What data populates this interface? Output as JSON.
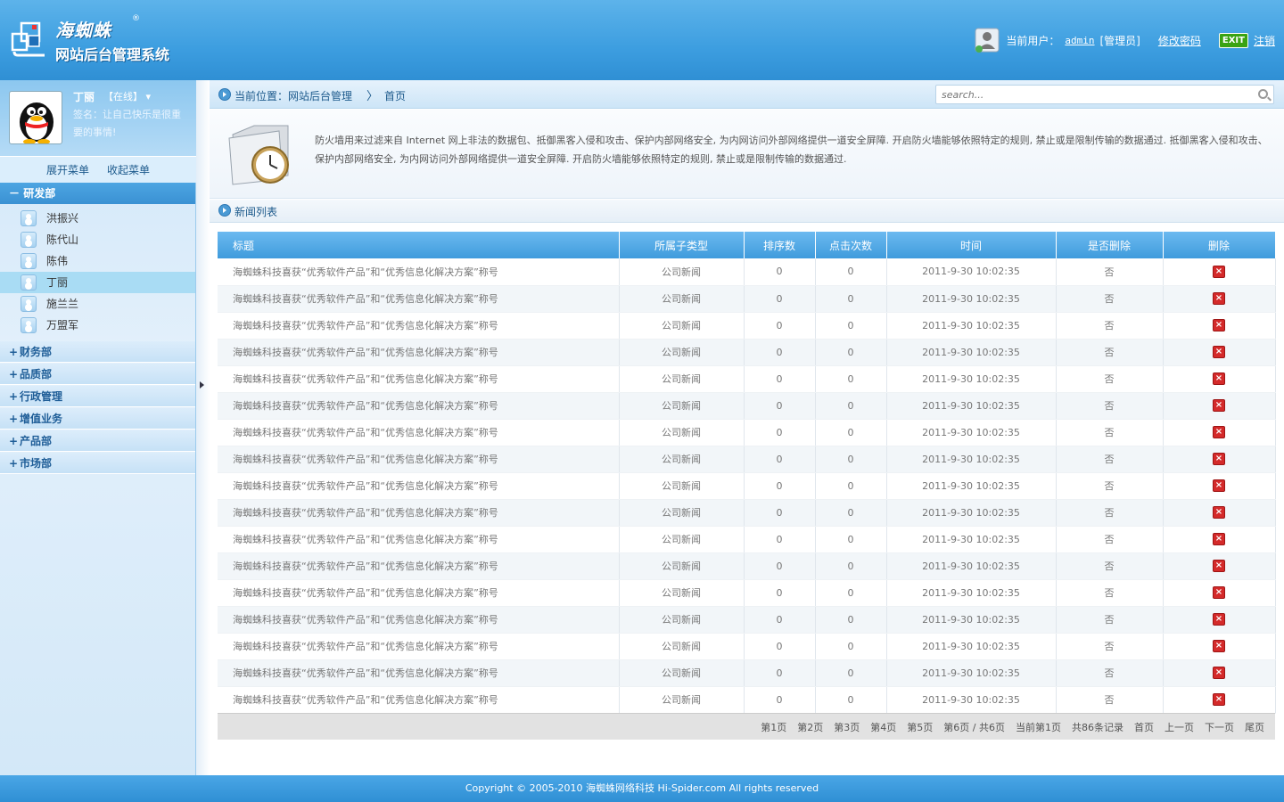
{
  "header": {
    "brand": "海蜘蛛",
    "brand_reg": "®",
    "subtitle": "网站后台管理系统",
    "user_label": "当前用户：",
    "user_name": "admin",
    "user_role": "[管理员]",
    "change_password": "修改密码",
    "exit_badge": "EXIT",
    "logout": "注销"
  },
  "profile": {
    "name": "丁丽",
    "status": "【在线】",
    "signature": "签名：让自己快乐是很重要的事情!"
  },
  "menu": {
    "expand": "展开菜单",
    "collapse": "收起菜单",
    "groups": [
      {
        "label": "研发部",
        "sign": "－",
        "open": true
      },
      {
        "label": "财务部",
        "sign": "+"
      },
      {
        "label": "品质部",
        "sign": "+"
      },
      {
        "label": "行政管理",
        "sign": "+"
      },
      {
        "label": "增值业务",
        "sign": "+"
      },
      {
        "label": "产品部",
        "sign": "+"
      },
      {
        "label": "市场部",
        "sign": "+"
      }
    ],
    "members": [
      "洪振兴",
      "陈代山",
      "陈伟",
      "丁丽",
      "施兰兰",
      "万盟军"
    ],
    "active_member": "丁丽"
  },
  "breadcrumb": {
    "label": "当前位置：网站后台管理",
    "separator": "〉",
    "home": "首页"
  },
  "search": {
    "placeholder": "search..."
  },
  "intro": {
    "text": "防火墙用来过滤来自 Internet 网上非法的数据包、抵御黑客入侵和攻击、保护内部网络安全, 为内网访问外部网络提供一道安全屏障. 开启防火墙能够依照特定的规则, 禁止或是限制传输的数据通过. 抵御黑客入侵和攻击、保护内部网络安全, 为内网访问外部网络提供一道安全屏障. 开启防火墙能够依照特定的规则, 禁止或是限制传输的数据通过."
  },
  "section": {
    "title": "新闻列表"
  },
  "table": {
    "headers": [
      "标题",
      "所属子类型",
      "排序数",
      "点击次数",
      "时间",
      "是否删除",
      "删除"
    ],
    "rows": [
      [
        "海蜘蛛科技喜获“优秀软件产品”和“优秀信息化解决方案”称号",
        "公司新闻",
        "0",
        "0",
        "2011-9-30 10:02:35",
        "否",
        "×"
      ],
      [
        "海蜘蛛科技喜获“优秀软件产品”和“优秀信息化解决方案”称号",
        "公司新闻",
        "0",
        "0",
        "2011-9-30 10:02:35",
        "否",
        "×"
      ],
      [
        "海蜘蛛科技喜获“优秀软件产品”和“优秀信息化解决方案”称号",
        "公司新闻",
        "0",
        "0",
        "2011-9-30 10:02:35",
        "否",
        "×"
      ],
      [
        "海蜘蛛科技喜获“优秀软件产品”和“优秀信息化解决方案”称号",
        "公司新闻",
        "0",
        "0",
        "2011-9-30 10:02:35",
        "否",
        "×"
      ],
      [
        "海蜘蛛科技喜获“优秀软件产品”和“优秀信息化解决方案”称号",
        "公司新闻",
        "0",
        "0",
        "2011-9-30 10:02:35",
        "否",
        "×"
      ],
      [
        "海蜘蛛科技喜获“优秀软件产品”和“优秀信息化解决方案”称号",
        "公司新闻",
        "0",
        "0",
        "2011-9-30 10:02:35",
        "否",
        "×"
      ],
      [
        "海蜘蛛科技喜获“优秀软件产品”和“优秀信息化解决方案”称号",
        "公司新闻",
        "0",
        "0",
        "2011-9-30 10:02:35",
        "否",
        "×"
      ],
      [
        "海蜘蛛科技喜获“优秀软件产品”和“优秀信息化解决方案”称号",
        "公司新闻",
        "0",
        "0",
        "2011-9-30 10:02:35",
        "否",
        "×"
      ],
      [
        "海蜘蛛科技喜获“优秀软件产品”和“优秀信息化解决方案”称号",
        "公司新闻",
        "0",
        "0",
        "2011-9-30 10:02:35",
        "否",
        "×"
      ],
      [
        "海蜘蛛科技喜获“优秀软件产品”和“优秀信息化解决方案”称号",
        "公司新闻",
        "0",
        "0",
        "2011-9-30 10:02:35",
        "否",
        "×"
      ],
      [
        "海蜘蛛科技喜获“优秀软件产品”和“优秀信息化解决方案”称号",
        "公司新闻",
        "0",
        "0",
        "2011-9-30 10:02:35",
        "否",
        "×"
      ],
      [
        "海蜘蛛科技喜获“优秀软件产品”和“优秀信息化解决方案”称号",
        "公司新闻",
        "0",
        "0",
        "2011-9-30 10:02:35",
        "否",
        "×"
      ],
      [
        "海蜘蛛科技喜获“优秀软件产品”和“优秀信息化解决方案”称号",
        "公司新闻",
        "0",
        "0",
        "2011-9-30 10:02:35",
        "否",
        "×"
      ],
      [
        "海蜘蛛科技喜获“优秀软件产品”和“优秀信息化解决方案”称号",
        "公司新闻",
        "0",
        "0",
        "2011-9-30 10:02:35",
        "否",
        "×"
      ],
      [
        "海蜘蛛科技喜获“优秀软件产品”和“优秀信息化解决方案”称号",
        "公司新闻",
        "0",
        "0",
        "2011-9-30 10:02:35",
        "否",
        "×"
      ],
      [
        "海蜘蛛科技喜获“优秀软件产品”和“优秀信息化解决方案”称号",
        "公司新闻",
        "0",
        "0",
        "2011-9-30 10:02:35",
        "否",
        "×"
      ],
      [
        "海蜘蛛科技喜获“优秀软件产品”和“优秀信息化解决方案”称号",
        "公司新闻",
        "0",
        "0",
        "2011-9-30 10:02:35",
        "否",
        "×"
      ]
    ]
  },
  "pager": {
    "items": [
      "第1页",
      "第2页",
      "第3页",
      "第4页",
      "第5页",
      "第6页 / 共6页",
      "当前第1页",
      "共86条记录",
      "首页",
      "上一页",
      "下一页",
      "尾页"
    ]
  },
  "footer": {
    "text": "Copyright © 2005-2010 海蜘蛛网络科技 Hi-Spider.com All rights reserved"
  },
  "colors": {
    "primary": "#3d9ee0",
    "header_dark": "#2f8fd4",
    "delete": "#d42a2a"
  }
}
